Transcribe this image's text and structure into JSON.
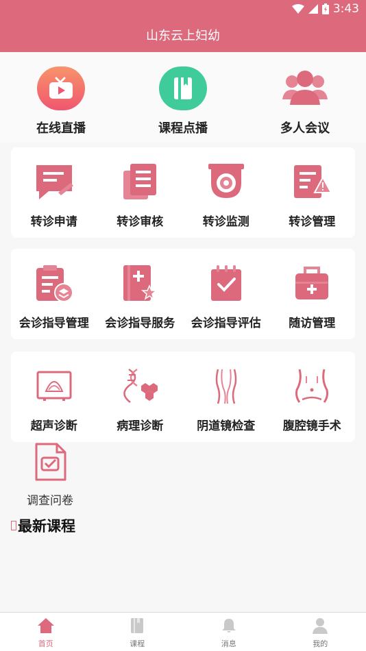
{
  "status_bar": {
    "time": "3:43"
  },
  "app_bar": {
    "title": "山东云上妇幼"
  },
  "top_features": [
    {
      "label": "在线直播",
      "icon": "tv-icon"
    },
    {
      "label": "课程点播",
      "icon": "book-icon"
    },
    {
      "label": "多人会议",
      "icon": "group-icon"
    }
  ],
  "referral_card": [
    {
      "label": "转诊申请",
      "icon": "referral-apply-icon"
    },
    {
      "label": "转诊审核",
      "icon": "referral-review-icon"
    },
    {
      "label": "转诊监测",
      "icon": "referral-monitor-icon"
    },
    {
      "label": "转诊管理",
      "icon": "referral-manage-icon"
    }
  ],
  "consult_card": [
    {
      "label": "会诊指导管理",
      "icon": "consult-manage-icon"
    },
    {
      "label": "会诊指导服务",
      "icon": "consult-service-icon"
    },
    {
      "label": "会诊指导评估",
      "icon": "consult-evaluate-icon"
    },
    {
      "label": "随访管理",
      "icon": "followup-icon"
    }
  ],
  "diagnosis_card": [
    {
      "label": "超声诊断",
      "icon": "ultrasound-icon"
    },
    {
      "label": "病理诊断",
      "icon": "pathology-icon"
    },
    {
      "label": "阴道镜检查",
      "icon": "colposcopy-icon"
    },
    {
      "label": "腹腔镜手术",
      "icon": "laparoscopy-icon"
    }
  ],
  "survey": {
    "label": "调查问卷",
    "icon": "survey-icon"
  },
  "latest_courses": {
    "title": "最新课程"
  },
  "tab_bar": [
    {
      "label": "首页",
      "icon": "home-icon",
      "active": true
    },
    {
      "label": "课程",
      "icon": "course-icon",
      "active": false
    },
    {
      "label": "消息",
      "icon": "bell-icon",
      "active": false
    },
    {
      "label": "我的",
      "icon": "user-icon",
      "active": false
    }
  ],
  "colors": {
    "primary": "#dc6a7c",
    "live_gradient": [
      "#f7946a",
      "#f0566f"
    ],
    "vod": "#3fcc9a"
  }
}
